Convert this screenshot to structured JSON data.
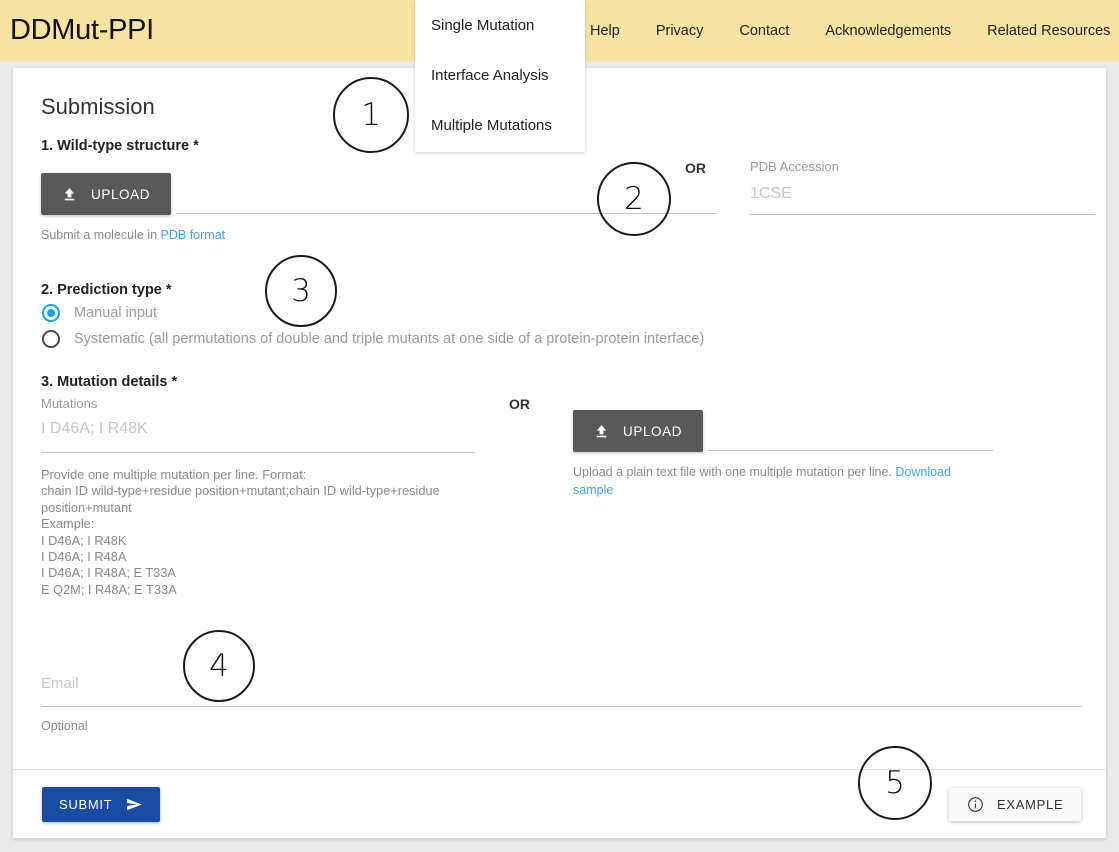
{
  "header": {
    "brand": "DDMut-PPI",
    "background_color": "#f9e3a2",
    "nav_items": [
      {
        "label": "Help"
      },
      {
        "label": "Privacy"
      },
      {
        "label": "Contact"
      },
      {
        "label": "Acknowledgements"
      },
      {
        "label": "Related Resources"
      }
    ]
  },
  "dropdown": {
    "items": [
      {
        "label": "Single Mutation"
      },
      {
        "label": "Interface Analysis"
      },
      {
        "label": "Multiple Mutations"
      }
    ]
  },
  "main": {
    "page_title": "Submission",
    "step1": {
      "label": "1. Wild-type structure *",
      "upload_label": "UPLOAD",
      "hint_prefix": "Submit a molecule in ",
      "hint_link": "PDB format",
      "or_label": "OR",
      "pdb_field_label": "PDB Accession",
      "pdb_placeholder": "1CSE"
    },
    "step2": {
      "label": "2. Prediction type *",
      "options": [
        {
          "label": "Manual input",
          "selected": true
        },
        {
          "label": "Systematic (all permutations of double and triple mutants at one side of a protein-protein interface)",
          "selected": false
        }
      ]
    },
    "step3": {
      "label": "3. Mutation details *",
      "mutations_field_label": "Mutations",
      "mutations_placeholder": "I D46A; I R48K",
      "format_help": "Provide one multiple mutation per line. Format:\nchain ID wild-type+residue position+mutant;chain ID wild-type+residue\nposition+mutant\nExample:\nI D46A; I R48K\nI D46A; I R48A\nI D46A; I R48A; E T33A\nE Q2M; I R48A; E T33A",
      "or_label": "OR",
      "upload_label": "UPLOAD",
      "upload_hint_prefix": "Upload a plain text file with one multiple mutation per line. ",
      "upload_hint_link": "Download sample"
    },
    "email": {
      "field_label": "Email",
      "optional_label": "Optional"
    },
    "submit_label": "SUBMIT",
    "example_label": "EXAMPLE"
  },
  "annotations": [
    {
      "number": "1"
    },
    {
      "number": "2"
    },
    {
      "number": "3"
    },
    {
      "number": "4"
    },
    {
      "number": "5"
    }
  ],
  "colors": {
    "header": "#f9e3a2",
    "submit": "#184da3",
    "upload": "#595959",
    "link": "#3da5e0",
    "radio_selected": "#0fa6e0"
  }
}
